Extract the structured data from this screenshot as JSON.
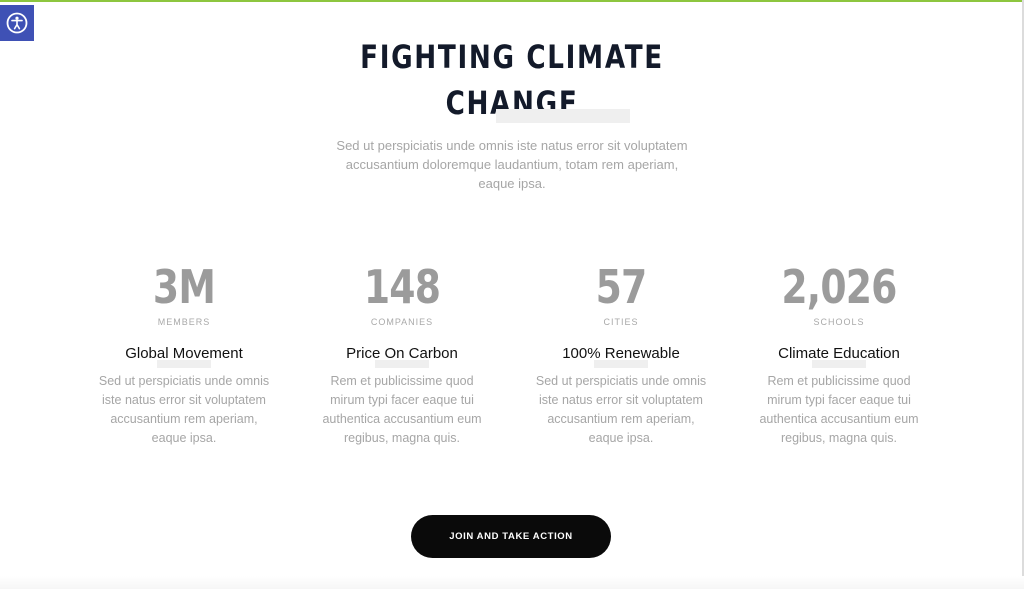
{
  "colors": {
    "accent_border": "#8dc63f",
    "accessibility_button": "#3f51b5",
    "heading": "#131a2a",
    "muted_text": "#a6a6a6",
    "stat_number": "#9b9b9b",
    "cta_background": "#0a0a0a",
    "cta_text": "#ffffff"
  },
  "accessibility": {
    "icon": "accessibility-person-icon"
  },
  "hero": {
    "heading_line1": "FIGHTING CLIMATE",
    "heading_line2": "CHANGE",
    "intro_line1": "Sed ut perspiciatis unde omnis iste natus error sit voluptatem",
    "intro_line2": "accusantium doloremque laudantium, totam rem aperiam,",
    "intro_line3": "eaque ipsa."
  },
  "stats": [
    {
      "number": "3M",
      "label": "MEMBERS",
      "title": "Global Movement",
      "desc_line1": "Sed ut perspiciatis unde omnis",
      "desc_line2": "iste natus error sit voluptatem",
      "desc_line3": "accusantium rem aperiam,",
      "desc_line4": "eaque ipsa."
    },
    {
      "number": "148",
      "label": "COMPANIES",
      "title": "Price On Carbon",
      "desc_line1": "Rem et publicissime quod",
      "desc_line2": "mirum typi facer eaque tui",
      "desc_line3": "authentica accusantium eum",
      "desc_line4": "regibus, magna quis."
    },
    {
      "number": "57",
      "label": "CITIES",
      "title": "100% Renewable",
      "desc_line1": "Sed ut perspiciatis unde omnis",
      "desc_line2": "iste natus error sit voluptatem",
      "desc_line3": "accusantium rem aperiam,",
      "desc_line4": "eaque ipsa."
    },
    {
      "number": "2,026",
      "label": "SCHOOLS",
      "title": "Climate Education",
      "desc_line1": "Rem et publicissime quod",
      "desc_line2": "mirum typi facer eaque tui",
      "desc_line3": "authentica accusantium eum",
      "desc_line4": "regibus, magna quis."
    }
  ],
  "cta": {
    "label": "JOIN AND TAKE ACTION"
  }
}
